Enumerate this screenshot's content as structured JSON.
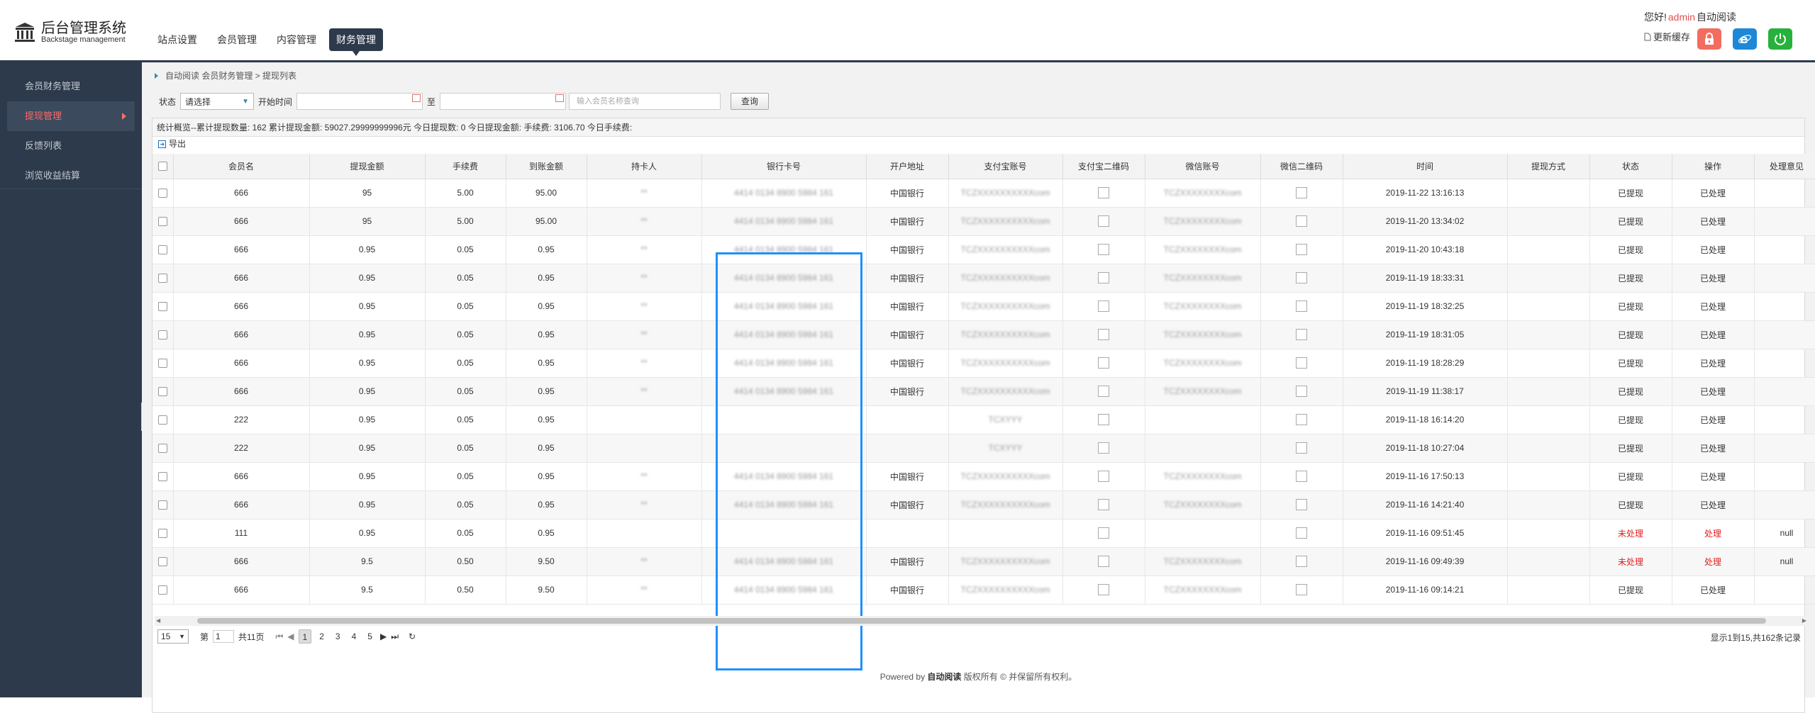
{
  "header": {
    "logo_title": "后台管理系统",
    "logo_subtitle": "Backstage management",
    "nav": [
      "站点设置",
      "会员管理",
      "内容管理",
      "财务管理"
    ],
    "active_nav": "财务管理",
    "greeting": "您好!",
    "user": "admin",
    "user_suffix": "自动阅读",
    "clear_cache": "更新缓存",
    "colors": {
      "lock": "#f36c5f",
      "browser": "#1e88d8",
      "power": "#27b13c"
    }
  },
  "sidebar": {
    "items": [
      "会员财务管理",
      "提现管理",
      "反馈列表",
      "浏览收益结算"
    ],
    "active": "提现管理"
  },
  "breadcrumb": "自动阅读 会员财务管理 > 提现列表",
  "filters": {
    "status_label": "状态",
    "status_value": "请选择",
    "start_label": "开始时间",
    "to_label": "至",
    "search_placeholder": "输入会员名称查询",
    "query_button": "查询"
  },
  "stats": "统计概览--累计提现数量: 162  累计提现金额: 59027.29999999996元  今日提现数: 0  今日提现金额:   手续费: 3106.70  今日手续费:",
  "toolbar": {
    "export": "导出"
  },
  "table": {
    "columns": [
      "会员名",
      "提现金额",
      "手续费",
      "到账金额",
      "持卡人",
      "银行卡号",
      "开户地址",
      "支付宝账号",
      "支付宝二维码",
      "微信账号",
      "微信二维码",
      "时间",
      "提现方式",
      "状态",
      "操作",
      "处理意见"
    ],
    "rows": [
      {
        "member": "666",
        "amount": "95",
        "fee": "5.00",
        "arrival": "95.00",
        "holder": "**",
        "card": "4414 0134 8900 5984 161",
        "bank": "中国银行",
        "alipay": "TCZXXXXXXXXXXcom",
        "wechat": "TCZXXXXXXXXcom",
        "time": "2019-11-22 13:16:13",
        "method": "",
        "status": "已提现",
        "op": "已处理",
        "note": ""
      },
      {
        "member": "666",
        "amount": "95",
        "fee": "5.00",
        "arrival": "95.00",
        "holder": "**",
        "card": "4414 0134 8900 5984 161",
        "bank": "中国银行",
        "alipay": "TCZXXXXXXXXXXcom",
        "wechat": "TCZXXXXXXXXcom",
        "time": "2019-11-20 13:34:02",
        "method": "",
        "status": "已提现",
        "op": "已处理",
        "note": ""
      },
      {
        "member": "666",
        "amount": "0.95",
        "fee": "0.05",
        "arrival": "0.95",
        "holder": "**",
        "card": "4414 0134 8900 5984 161",
        "bank": "中国银行",
        "alipay": "TCZXXXXXXXXXXcom",
        "wechat": "TCZXXXXXXXXcom",
        "time": "2019-11-20 10:43:18",
        "method": "",
        "status": "已提现",
        "op": "已处理",
        "note": ""
      },
      {
        "member": "666",
        "amount": "0.95",
        "fee": "0.05",
        "arrival": "0.95",
        "holder": "**",
        "card": "4414 0134 8900 5984 161",
        "bank": "中国银行",
        "alipay": "TCZXXXXXXXXXXcom",
        "wechat": "TCZXXXXXXXXcom",
        "time": "2019-11-19 18:33:31",
        "method": "",
        "status": "已提现",
        "op": "已处理",
        "note": ""
      },
      {
        "member": "666",
        "amount": "0.95",
        "fee": "0.05",
        "arrival": "0.95",
        "holder": "**",
        "card": "4414 0134 8900 5984 161",
        "bank": "中国银行",
        "alipay": "TCZXXXXXXXXXXcom",
        "wechat": "TCZXXXXXXXXcom",
        "time": "2019-11-19 18:32:25",
        "method": "",
        "status": "已提现",
        "op": "已处理",
        "note": ""
      },
      {
        "member": "666",
        "amount": "0.95",
        "fee": "0.05",
        "arrival": "0.95",
        "holder": "**",
        "card": "4414 0134 8900 5984 161",
        "bank": "中国银行",
        "alipay": "TCZXXXXXXXXXXcom",
        "wechat": "TCZXXXXXXXXcom",
        "time": "2019-11-19 18:31:05",
        "method": "",
        "status": "已提现",
        "op": "已处理",
        "note": ""
      },
      {
        "member": "666",
        "amount": "0.95",
        "fee": "0.05",
        "arrival": "0.95",
        "holder": "**",
        "card": "4414 0134 8900 5984 161",
        "bank": "中国银行",
        "alipay": "TCZXXXXXXXXXXcom",
        "wechat": "TCZXXXXXXXXcom",
        "time": "2019-11-19 18:28:29",
        "method": "",
        "status": "已提现",
        "op": "已处理",
        "note": ""
      },
      {
        "member": "666",
        "amount": "0.95",
        "fee": "0.05",
        "arrival": "0.95",
        "holder": "**",
        "card": "4414 0134 8900 5984 161",
        "bank": "中国银行",
        "alipay": "TCZXXXXXXXXXXcom",
        "wechat": "TCZXXXXXXXXcom",
        "time": "2019-11-19 11:38:17",
        "method": "",
        "status": "已提现",
        "op": "已处理",
        "note": ""
      },
      {
        "member": "222",
        "amount": "0.95",
        "fee": "0.05",
        "arrival": "0.95",
        "holder": "",
        "card": "",
        "bank": "",
        "alipay": "TCXYYY",
        "wechat": "",
        "time": "2019-11-18 16:14:20",
        "method": "",
        "status": "已提现",
        "op": "已处理",
        "note": ""
      },
      {
        "member": "222",
        "amount": "0.95",
        "fee": "0.05",
        "arrival": "0.95",
        "holder": "",
        "card": "",
        "bank": "",
        "alipay": "TCXYYY",
        "wechat": "",
        "time": "2019-11-18 10:27:04",
        "method": "",
        "status": "已提现",
        "op": "已处理",
        "note": ""
      },
      {
        "member": "666",
        "amount": "0.95",
        "fee": "0.05",
        "arrival": "0.95",
        "holder": "**",
        "card": "4414 0134 8900 5984 161",
        "bank": "中国银行",
        "alipay": "TCZXXXXXXXXXXcom",
        "wechat": "TCZXXXXXXXXcom",
        "time": "2019-11-16 17:50:13",
        "method": "",
        "status": "已提现",
        "op": "已处理",
        "note": ""
      },
      {
        "member": "666",
        "amount": "0.95",
        "fee": "0.05",
        "arrival": "0.95",
        "holder": "**",
        "card": "4414 0134 8900 5984 161",
        "bank": "中国银行",
        "alipay": "TCZXXXXXXXXXXcom",
        "wechat": "TCZXXXXXXXXcom",
        "time": "2019-11-16 14:21:40",
        "method": "",
        "status": "已提现",
        "op": "已处理",
        "note": ""
      },
      {
        "member": "111",
        "amount": "0.95",
        "fee": "0.05",
        "arrival": "0.95",
        "holder": "",
        "card": "",
        "bank": "",
        "alipay": "",
        "wechat": "",
        "time": "2019-11-16 09:51:45",
        "method": "",
        "status": "未处理",
        "op": "处理",
        "note": "null"
      },
      {
        "member": "666",
        "amount": "9.5",
        "fee": "0.50",
        "arrival": "9.50",
        "holder": "**",
        "card": "4414 0134 8900 5984 161",
        "bank": "中国银行",
        "alipay": "TCZXXXXXXXXXXcom",
        "wechat": "TCZXXXXXXXXcom",
        "time": "2019-11-16 09:49:39",
        "method": "",
        "status": "未处理",
        "op": "处理",
        "note": "null"
      },
      {
        "member": "666",
        "amount": "9.5",
        "fee": "0.50",
        "arrival": "9.50",
        "holder": "**",
        "card": "4414 0134 8900 5984 161",
        "bank": "中国银行",
        "alipay": "TCZXXXXXXXXXXcom",
        "wechat": "TCZXXXXXXXXcom",
        "time": "2019-11-16 09:14:21",
        "method": "",
        "status": "已提现",
        "op": "已处理",
        "note": ""
      }
    ]
  },
  "pager": {
    "page_size": "15",
    "page_label": "第",
    "page_value": "1",
    "total_pages": "共11页",
    "pages": [
      "1",
      "2",
      "3",
      "4",
      "5"
    ],
    "current": "1",
    "info": "显示1到15,共162条记录"
  },
  "footer": {
    "prefix": "Powered by",
    "brand": "自动阅读",
    "suffix": "版权所有 © 并保留所有权利。"
  }
}
